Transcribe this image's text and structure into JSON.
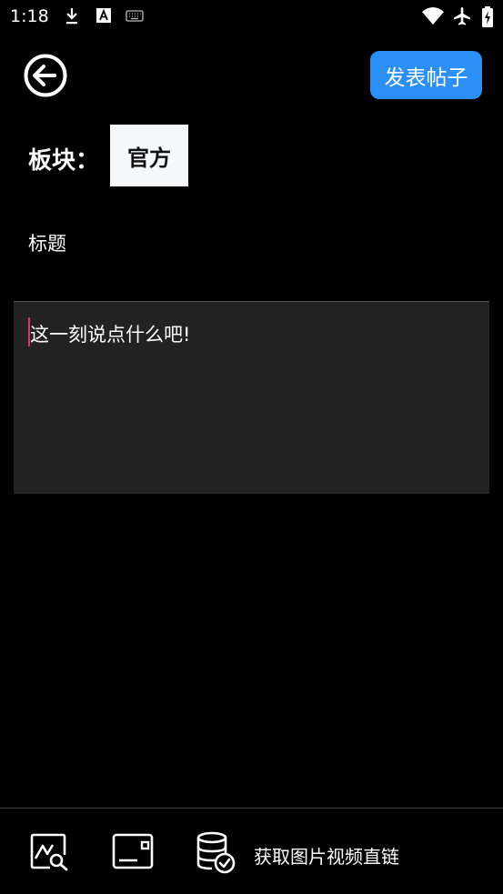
{
  "status_bar": {
    "time": "1:18",
    "icons": [
      "download-icon",
      "font-icon",
      "keyboard-icon",
      "wifi-icon",
      "airplane-icon",
      "battery-charging-icon"
    ]
  },
  "header": {
    "back_icon": "arrow-left-circle-icon",
    "publish_label": "发表帖子"
  },
  "section": {
    "label": "板块：",
    "value": "官方"
  },
  "form": {
    "title_placeholder": "标题",
    "content_placeholder": "这一刻说点什么吧!"
  },
  "toolbar": {
    "image_icon": "image-search-icon",
    "card_icon": "card-icon",
    "database_icon": "database-check-icon",
    "link_label": "获取图片视频直链"
  },
  "colors": {
    "accent": "#2b8ff5",
    "cursor": "#e0336a",
    "editor_bg": "#222222"
  }
}
